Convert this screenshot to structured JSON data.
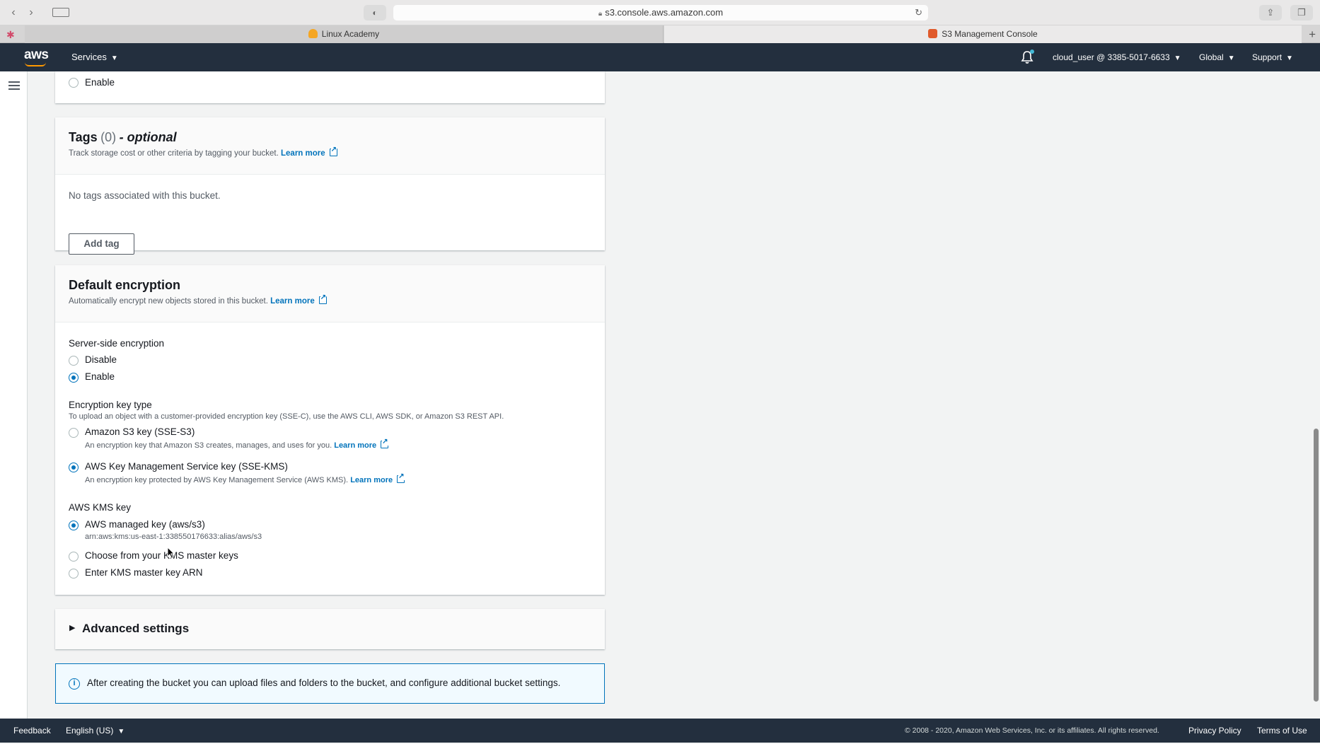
{
  "browser": {
    "url": "s3.console.aws.amazon.com",
    "tabs": [
      {
        "label": "Linux Academy"
      },
      {
        "label": "S3 Management Console"
      }
    ]
  },
  "header": {
    "services_label": "Services",
    "account_label": "cloud_user @ 3385-5017-6633",
    "region_label": "Global",
    "support_label": "Support"
  },
  "top_partial": {
    "enable_label": "Enable"
  },
  "tags": {
    "title": "Tags",
    "count": "(0)",
    "optional": "- optional",
    "description": "Track storage cost or other criteria by tagging your bucket.",
    "learn_more": "Learn more",
    "empty_text": "No tags associated with this bucket.",
    "add_button": "Add tag"
  },
  "encryption": {
    "title": "Default encryption",
    "description": "Automatically encrypt new objects stored in this bucket.",
    "learn_more": "Learn more",
    "sse_label": "Server-side encryption",
    "sse_options": [
      {
        "label": "Disable",
        "selected": false
      },
      {
        "label": "Enable",
        "selected": true
      }
    ],
    "key_type_label": "Encryption key type",
    "key_type_desc": "To upload an object with a customer-provided encryption key (SSE-C), use the AWS CLI, AWS SDK, or Amazon S3 REST API.",
    "key_types": [
      {
        "label": "Amazon S3 key (SSE-S3)",
        "desc": "An encryption key that Amazon S3 creates, manages, and uses for you.",
        "learn_more": "Learn more",
        "selected": false
      },
      {
        "label": "AWS Key Management Service key (SSE-KMS)",
        "desc": "An encryption key protected by AWS Key Management Service (AWS KMS).",
        "learn_more": "Learn more",
        "selected": true
      }
    ],
    "kms_label": "AWS KMS key",
    "kms_options": [
      {
        "label": "AWS managed key (aws/s3)",
        "arn": "arn:aws:kms:us-east-1:338550176633:alias/aws/s3",
        "selected": true
      },
      {
        "label": "Choose from your KMS master keys",
        "selected": false
      },
      {
        "label": "Enter KMS master key ARN",
        "selected": false
      }
    ]
  },
  "advanced": {
    "title": "Advanced settings"
  },
  "info": {
    "text": "After creating the bucket you can upload files and folders to the bucket, and configure additional bucket settings."
  },
  "footer": {
    "feedback": "Feedback",
    "language": "English (US)",
    "copyright": "© 2008 - 2020, Amazon Web Services, Inc. or its affiliates. All rights reserved.",
    "privacy": "Privacy Policy",
    "terms": "Terms of Use"
  },
  "colors": {
    "header_bg": "#232f3e",
    "accent_orange": "#ff9900",
    "link_blue": "#0073bb",
    "page_bg": "#f2f3f3"
  }
}
